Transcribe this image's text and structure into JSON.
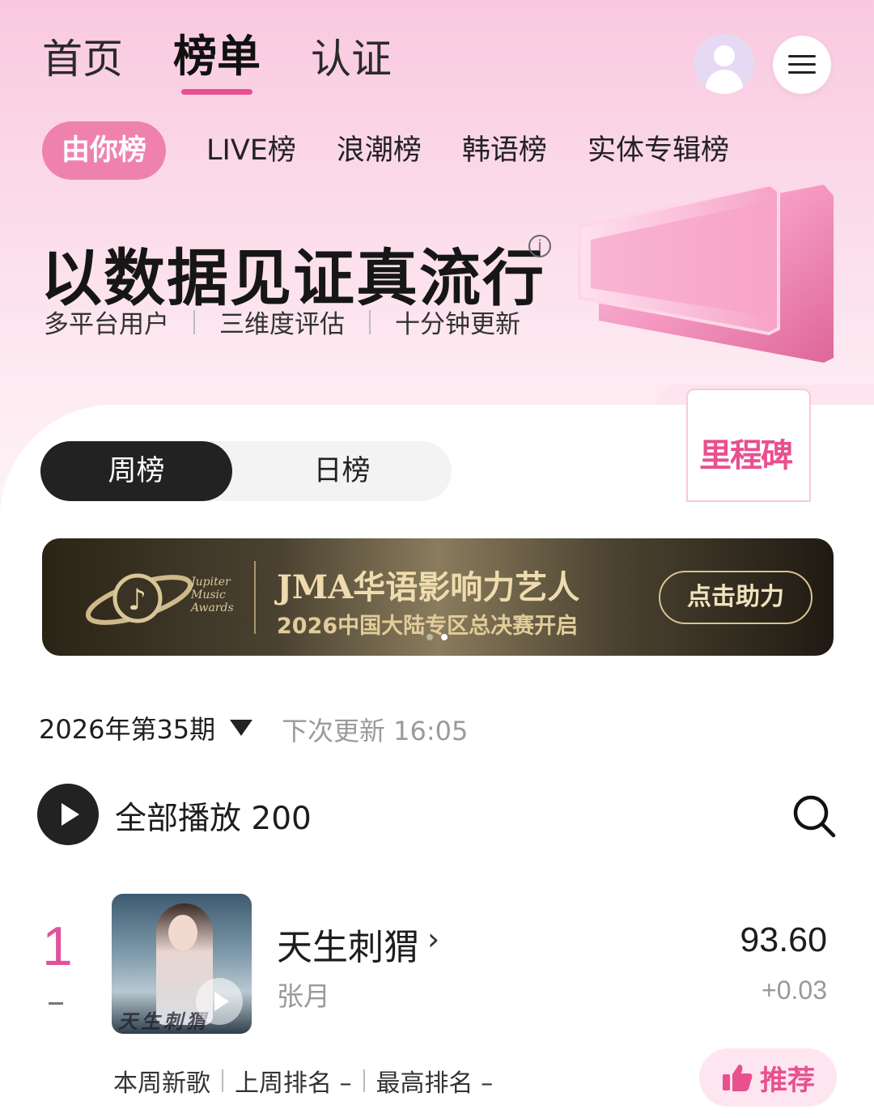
{
  "top_nav": {
    "tabs": [
      {
        "label": "首页"
      },
      {
        "label": "榜单"
      },
      {
        "label": "认证"
      }
    ]
  },
  "sub_tabs": [
    {
      "label": "由你榜"
    },
    {
      "label": "LIVE榜"
    },
    {
      "label": "浪潮榜"
    },
    {
      "label": "韩语榜"
    },
    {
      "label": "实体专辑榜"
    }
  ],
  "hero": {
    "title": "以数据见证真流行",
    "info_icon": "i",
    "features": [
      "多平台用户",
      "三维度评估",
      "十分钟更新"
    ],
    "milestone_label": "里程碑"
  },
  "period_toggle": {
    "weekly": "周榜",
    "daily": "日榜"
  },
  "banner": {
    "brand_lines": [
      "Jupiter",
      "Music",
      "Awards"
    ],
    "title": "JMA华语影响力艺人",
    "subtitle": "2026中国大陆专区总决赛开启",
    "button": "点击助力"
  },
  "chart_info": {
    "period": "2026年第35期",
    "next_update": "下次更新 16:05"
  },
  "play_all": {
    "label": "全部播放 200"
  },
  "songs": [
    {
      "rank": "1",
      "title": "天生刺猬",
      "artist": "张月",
      "score": "93.60",
      "delta": "+0.03",
      "cover_text": "天生刺猬",
      "new_label": "本周新歌",
      "last_week": "上周排名 –",
      "best_rank": "最高排名 –",
      "recommend": "推荐"
    }
  ],
  "colors": {
    "accent": "#e8508f",
    "pill_active": "#ef82ad",
    "dark": "#222222"
  }
}
